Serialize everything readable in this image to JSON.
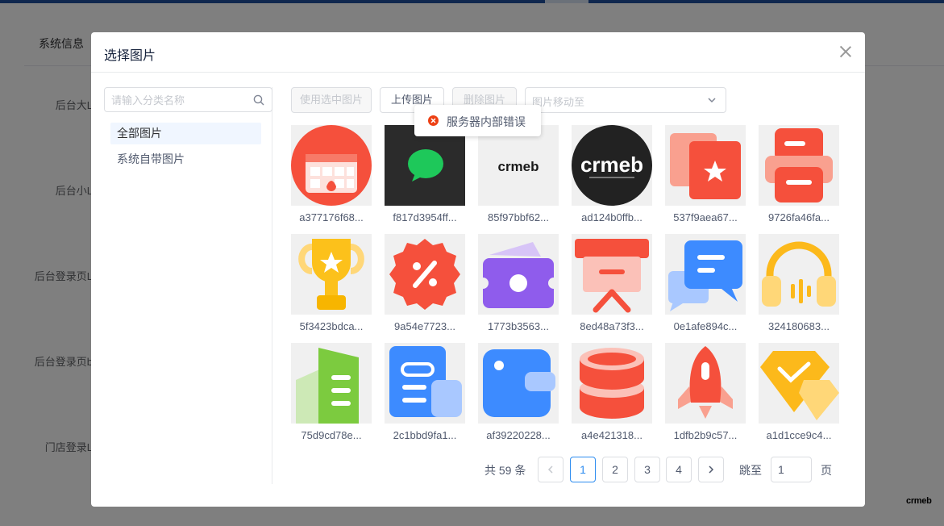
{
  "background": {
    "tab_label": "系统信息",
    "labels": [
      "后台大L",
      "后台小L",
      "后台登录页L",
      "后台登录页b",
      "门店登录L"
    ],
    "logo_text": "crmeb"
  },
  "modal": {
    "title": "选择图片",
    "close_icon": "close-icon"
  },
  "sidebar": {
    "search_placeholder": "请输入分类名称",
    "categories": [
      {
        "label": "全部图片",
        "active": true
      },
      {
        "label": "系统自带图片",
        "active": false
      }
    ]
  },
  "toolbar": {
    "use_selected": "使用选中图片",
    "upload": "上传图片",
    "delete": "删除图片",
    "move_placeholder": "图片移动至"
  },
  "toast": {
    "icon": "error-icon",
    "message": "服务器内部错误",
    "color": "#ed4014"
  },
  "images": [
    {
      "name": "a377176f68...",
      "icon": "calendar-icon"
    },
    {
      "name": "f817d3954ff...",
      "icon": "wechat-icon"
    },
    {
      "name": "85f97bbf62...",
      "icon": "crmeb-logo-light",
      "text": "crmeb"
    },
    {
      "name": "ad124b0ffb...",
      "icon": "crmeb-logo-dark",
      "text": "crmeb"
    },
    {
      "name": "537f9aea67...",
      "icon": "favorite-card-icon"
    },
    {
      "name": "9726fa46fa...",
      "icon": "printer-icon"
    },
    {
      "name": "5f3423bdca...",
      "icon": "trophy-icon"
    },
    {
      "name": "9a54e7723...",
      "icon": "discount-badge-icon"
    },
    {
      "name": "1773b3563...",
      "icon": "wallet-icon"
    },
    {
      "name": "8ed48a73f3...",
      "icon": "presentation-icon"
    },
    {
      "name": "0e1afe894c...",
      "icon": "chat-bubbles-icon"
    },
    {
      "name": "324180683...",
      "icon": "headphones-icon"
    },
    {
      "name": "75d9cd78e...",
      "icon": "building-icon"
    },
    {
      "name": "2c1bbd9fa1...",
      "icon": "document-icon"
    },
    {
      "name": "af39220228...",
      "icon": "blue-wallet-icon"
    },
    {
      "name": "a4e421318...",
      "icon": "database-icon"
    },
    {
      "name": "1dfb2b9c57...",
      "icon": "rocket-icon"
    },
    {
      "name": "a1d1cce9c4...",
      "icon": "diamond-icon"
    }
  ],
  "pagination": {
    "total_text": "共 59 条",
    "pages": [
      "1",
      "2",
      "3",
      "4"
    ],
    "current": "1",
    "jump_label": "跳至",
    "jump_value": "1",
    "page_unit": "页"
  },
  "colors": {
    "accent": "#2d8cf0",
    "error": "#ed4014"
  }
}
